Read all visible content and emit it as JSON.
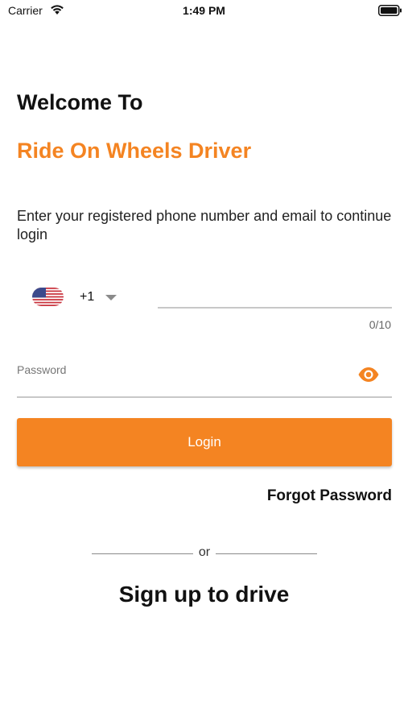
{
  "status_bar": {
    "carrier": "Carrier",
    "time": "1:49 PM",
    "wifi_icon": "wifi-icon",
    "battery_icon": "battery-icon"
  },
  "header": {
    "welcome": "Welcome To",
    "brand": "Ride On Wheels Driver"
  },
  "instructions": "Enter your registered phone number and email to continue login",
  "phone": {
    "flag_icon": "us-flag-icon",
    "country_code": "+1",
    "value": "",
    "placeholder": "",
    "counter": "0/10"
  },
  "password": {
    "label": "Password",
    "value": "",
    "eye_icon": "eye-icon"
  },
  "login_label": "Login",
  "forgot_label": "Forgot Password",
  "or_label": "or",
  "signup_label": "Sign up to drive",
  "colors": {
    "accent": "#f48422",
    "text": "#111111",
    "underline": "#c8c8c8"
  }
}
